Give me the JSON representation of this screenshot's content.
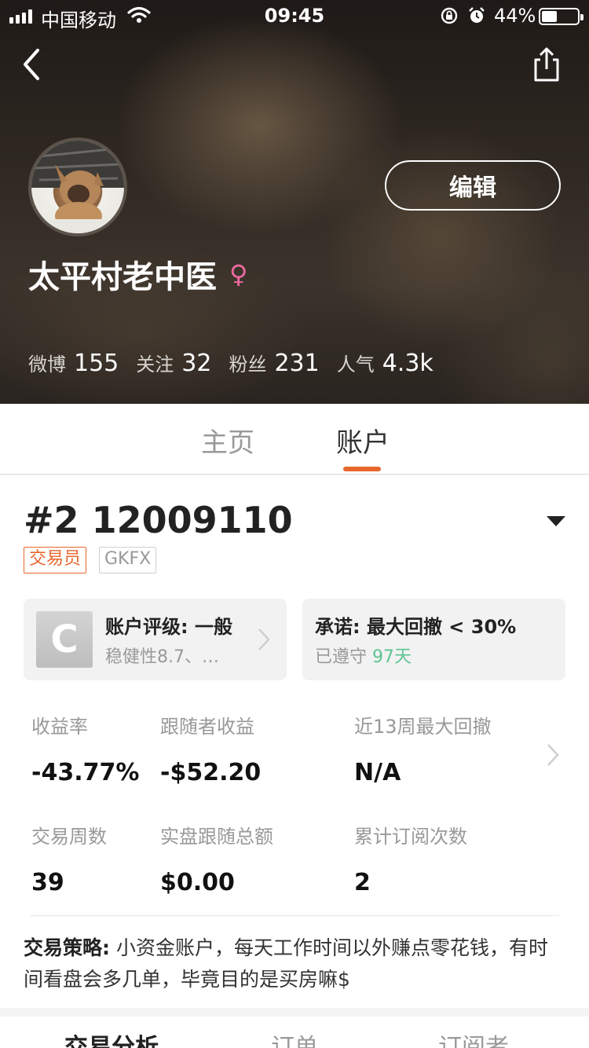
{
  "status_bar": {
    "carrier": "中国移动",
    "time": "09:45",
    "battery": "44%",
    "battery_level": 0.44
  },
  "profile": {
    "edit_label": "编辑",
    "username": "太平村老中医",
    "gender_symbol": "♀",
    "stats": [
      {
        "label": "微博",
        "value": "155"
      },
      {
        "label": "关注",
        "value": "32"
      },
      {
        "label": "粉丝",
        "value": "231"
      },
      {
        "label": "人气",
        "value": "4.3k"
      }
    ]
  },
  "tabs": [
    {
      "label": "主页"
    },
    {
      "label": "账户"
    }
  ],
  "account": {
    "id": "#2 12009110",
    "tags": [
      "交易员",
      "GKFX"
    ],
    "rating": {
      "grade": "C",
      "title": "账户评级: 一般",
      "subtitle": "稳健性8.7、…"
    },
    "commitment": {
      "title": "承诺: 最大回撤 < 30%",
      "status_prefix": "已遵守",
      "days": "97天"
    },
    "metrics": [
      {
        "label": "收益率",
        "value": "-43.77%"
      },
      {
        "label": "跟随者收益",
        "value": "-$52.20"
      },
      {
        "label": "近13周最大回撤",
        "value": "N/A"
      },
      {
        "label": "交易周数",
        "value": "39"
      },
      {
        "label": "实盘跟随总额",
        "value": "$0.00"
      },
      {
        "label": "累计订阅次数",
        "value": "2"
      }
    ],
    "strategy_label": "交易策略:",
    "strategy_text": " 小资金账户，每天工作时间以外赚点零花钱，有时间看盘会多几单，毕竟目的是买房嘛$"
  },
  "sub_tabs": [
    {
      "label": "交易分析"
    },
    {
      "label": "订单"
    },
    {
      "label": "订阅者"
    }
  ],
  "colors": {
    "accent": "#e8662c",
    "success": "#5cc592",
    "gender": "#ec6aa0"
  }
}
